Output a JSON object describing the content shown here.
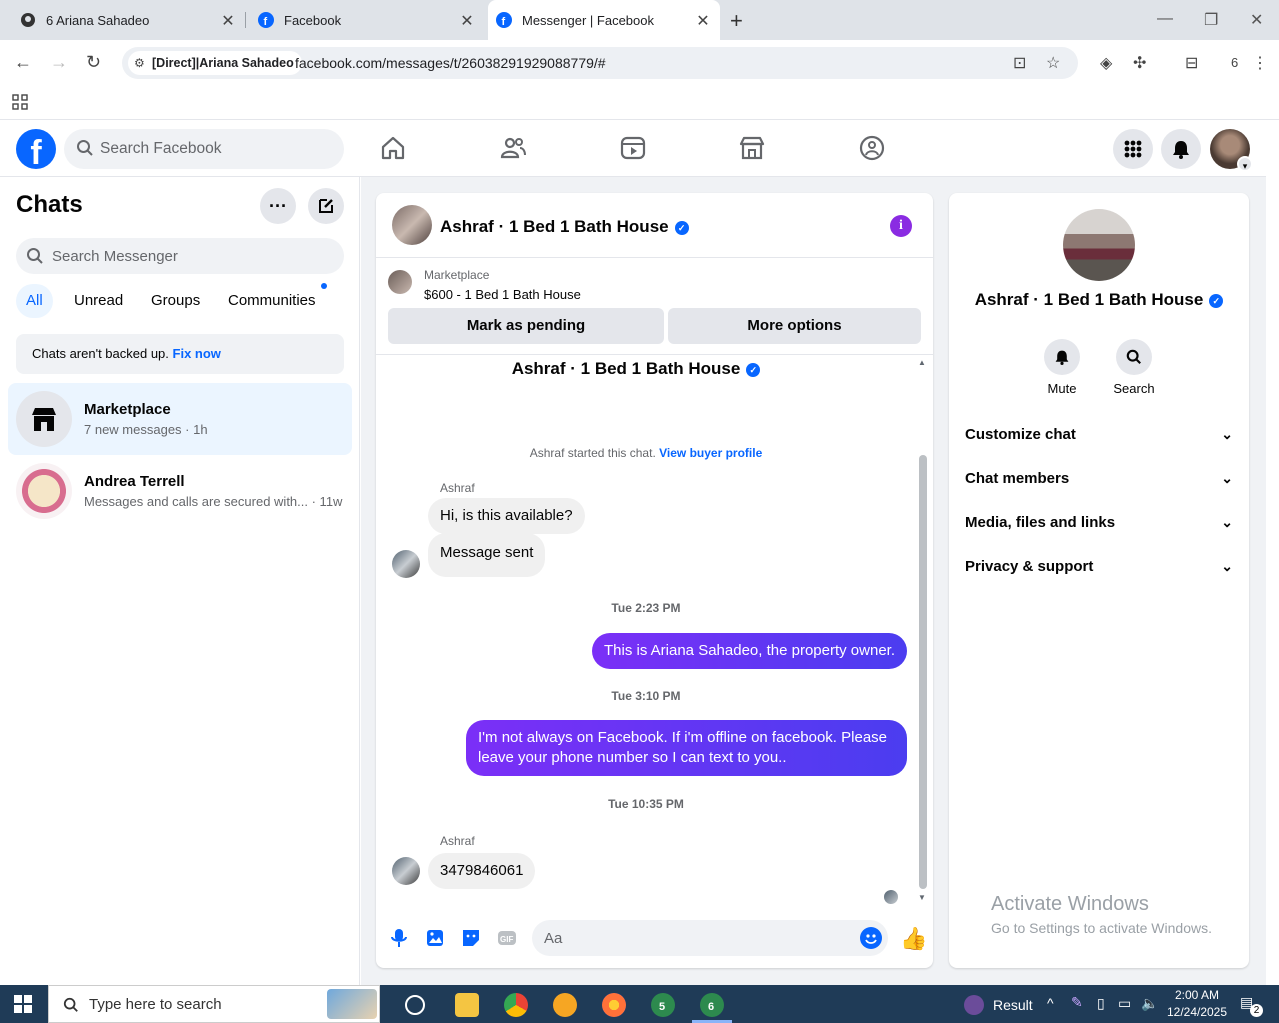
{
  "browser": {
    "tabs": [
      {
        "title": "6 Ariana Sahadeo",
        "active": false
      },
      {
        "title": "Facebook",
        "active": false
      },
      {
        "title": "Messenger | Facebook",
        "active": true
      }
    ],
    "site_chip": "[Direct]|Ariana Sahadeo",
    "url": "facebook.com/messages/t/26038291929088779/#",
    "profile_count": "6"
  },
  "fb": {
    "search_placeholder": "Search Facebook"
  },
  "sidebar": {
    "title": "Chats",
    "search_placeholder": "Search Messenger",
    "filters": [
      "All",
      "Unread",
      "Groups",
      "Communities"
    ],
    "backup_text": "Chats aren't backed up.",
    "backup_link": "Fix now",
    "chats": [
      {
        "name": "Marketplace",
        "preview": "7 new messages · 1h"
      },
      {
        "name": "Andrea Terrell",
        "preview": "Messages and calls are secured with... · 11w"
      }
    ]
  },
  "conversation": {
    "name": "Ashraf · 1 Bed 1 Bath House",
    "marketplace_label": "Marketplace",
    "listing": "$600 - 1 Bed 1 Bath House",
    "mark_pending": "Mark as pending",
    "more_options": "More options",
    "system_text": "Ashraf started this chat.",
    "system_link": "View buyer profile",
    "sender1": "Ashraf",
    "msg1": "Hi, is this available?",
    "msg2": "Message sent",
    "time1": "Tue 2:23 PM",
    "out1": "This is Ariana Sahadeo, the property owner.",
    "time2": "Tue 3:10 PM",
    "out2": "I'm not always on Facebook. If i'm offline on facebook. Please leave your phone number so I can text to you..",
    "time3": "Tue 10:35 PM",
    "sender2": "Ashraf",
    "msg3": "3479846061",
    "composer_placeholder": "Aa"
  },
  "rightpanel": {
    "name": "Ashraf · 1 Bed 1 Bath House",
    "actions": [
      "Mute",
      "Search"
    ],
    "sections": [
      "Customize chat",
      "Chat members",
      "Media, files and links",
      "Privacy & support"
    ]
  },
  "watermark": {
    "line1": "Activate Windows",
    "line2": "Go to Settings to activate Windows."
  },
  "taskbar": {
    "search_placeholder": "Type here to search",
    "badge_a": "5",
    "badge_b": "6",
    "weather_label": "Result",
    "time": "2:00 AM",
    "date": "12/24/2025",
    "notif_count": "2"
  },
  "colors": {
    "fb_blue": "#0866ff",
    "outgoing_bubble_start": "#7b2ff7",
    "outgoing_bubble_end": "#4b3df0"
  }
}
